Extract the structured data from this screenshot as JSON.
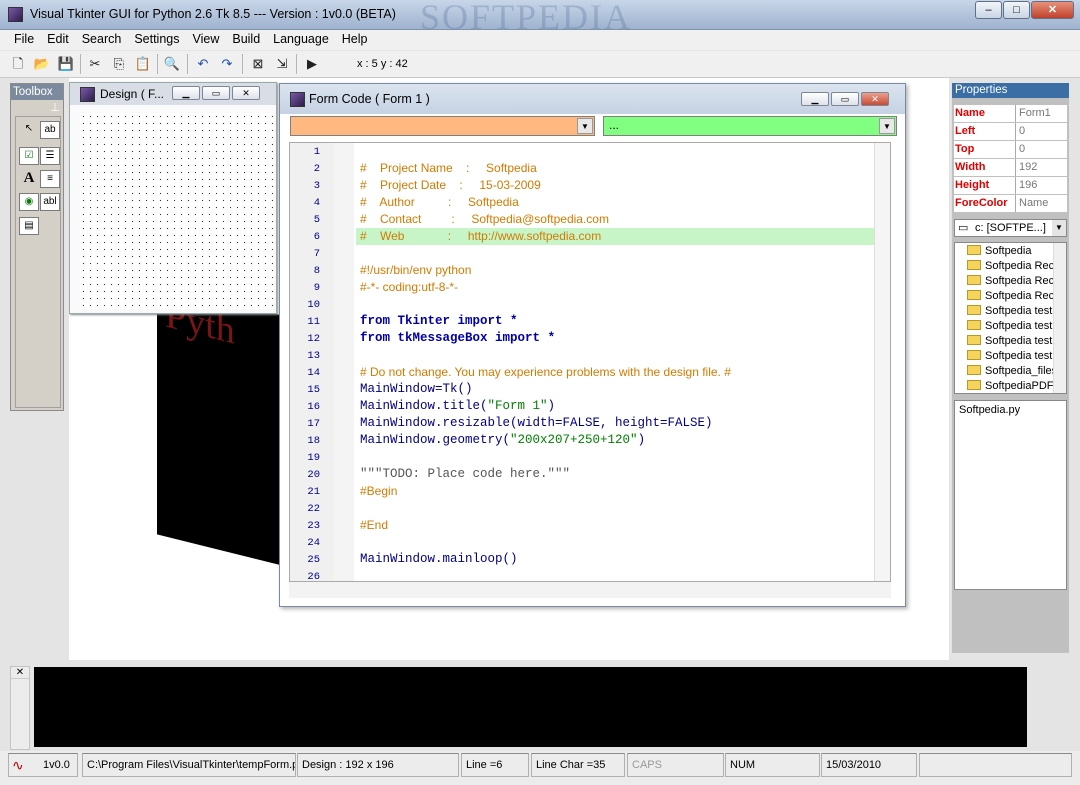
{
  "app": {
    "title": "Visual Tkinter GUI for Python 2.6 Tk 8.5 --- Version : 1v0.0 (BETA)",
    "watermark": "SOFTPEDIA",
    "min": "–",
    "max": "□",
    "close": "✕"
  },
  "menu": [
    "File",
    "Edit",
    "Search",
    "Settings",
    "View",
    "Build",
    "Language",
    "Help"
  ],
  "toolbar": {
    "coords": "x : 5  y : 42"
  },
  "toolbox": {
    "title": "Toolbox",
    "pin": "⊥",
    "tools": [
      "pointer",
      "text-label",
      "checkbox",
      "listbox",
      "label",
      "textbox-multi",
      "radio",
      "entry",
      "form"
    ]
  },
  "design_window": {
    "title": "Design ( F..."
  },
  "background_text": "Pyth",
  "form_code": {
    "title": "Form Code ( Form 1 )",
    "combo_left": "",
    "combo_right": "...",
    "combo_left_color": "#ffb980",
    "combo_right_color": "#80ff80",
    "line_numbers": [
      "1",
      "2",
      "3",
      "4",
      "5",
      "6",
      "7",
      "8",
      "9",
      "10",
      "11",
      "12",
      "13",
      "14",
      "15",
      "16",
      "17",
      "18",
      "19",
      "20",
      "21",
      "22",
      "23",
      "24",
      "25",
      "26"
    ],
    "lines": {
      "l2": "#    Project Name    :     Softpedia",
      "l3": "#    Project Date    :     15-03-2009",
      "l4": "#    Author          :     Softpedia",
      "l5": "#    Contact         :     Softpedia@softpedia.com",
      "l6": "#    Web             :     http://www.softpedia.com",
      "l8": "#!/usr/bin/env python",
      "l9": "#-*- coding:utf-8-*-",
      "l11a": "from",
      "l11b": " Tkinter ",
      "l11c": "import",
      "l11d": " *",
      "l12a": "from",
      "l12b": " tkMessageBox ",
      "l12c": "import",
      "l12d": " *",
      "l14": "# Do not change. You may experience problems with the design file. #",
      "l15": "MainWindow=Tk()",
      "l16a": "MainWindow.title(",
      "l16b": "\"Form 1\"",
      "l16c": ")",
      "l17": "MainWindow.resizable(width=FALSE, height=FALSE)",
      "l18a": "MainWindow.geometry(",
      "l18b": "\"200x207+250+120\"",
      "l18c": ")",
      "l20": "\"\"\"TODO: Place code here.\"\"\"",
      "l21": "#Begin",
      "l23": "#End",
      "l25": "MainWindow.mainloop()"
    }
  },
  "properties": {
    "title": "Properties",
    "rows": [
      {
        "k": "Name",
        "v": "Form1"
      },
      {
        "k": "Left",
        "v": "0"
      },
      {
        "k": "Top",
        "v": "0"
      },
      {
        "k": "Width",
        "v": "192"
      },
      {
        "k": "Height",
        "v": "196"
      },
      {
        "k": "ForeColor",
        "v": "Name"
      }
    ],
    "drive": "c: [SOFTPE...]",
    "folders": [
      "Softpedia",
      "Softpedia Rec",
      "Softpedia Rec",
      "Softpedia Rec",
      "Softpedia test",
      "Softpedia test",
      "Softpedia test",
      "Softpedia test",
      "Softpedia_files",
      "SoftpediaPDF"
    ],
    "file": "Softpedia.py"
  },
  "status": {
    "version": "1v0.0",
    "path": "C:\\Program Files\\VisualTkinter\\tempForm.py",
    "design": "Design : 192 x 196",
    "line": "Line =6",
    "linechar": "Line Char =35",
    "caps": "CAPS",
    "num": "NUM",
    "date": "15/03/2010"
  }
}
